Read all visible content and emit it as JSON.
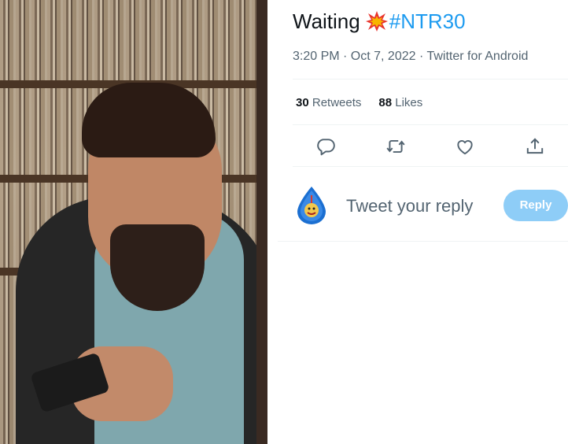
{
  "photo": {
    "alt": "Man with beard looking at phone in front of record shelves"
  },
  "tweet": {
    "text_prefix": "Waiting",
    "emoji": "collision-burst-icon",
    "hashtag": "#NTR30",
    "time": "3:20 PM",
    "separator": "·",
    "date": "Oct 7, 2022",
    "source": "Twitter for Android",
    "meta_full": "3:20 PM · Oct 7, 2022 · Twitter for Android"
  },
  "stats": {
    "retweets_count": "30",
    "retweets_label": "Retweets",
    "likes_count": "88",
    "likes_label": "Likes"
  },
  "actions": {
    "reply_icon": "reply-icon",
    "retweet_icon": "retweet-icon",
    "like_icon": "heart-icon",
    "share_icon": "share-icon"
  },
  "composer": {
    "placeholder": "Tweet your reply",
    "button_label": "Reply",
    "avatar_icon": "avatar-icon"
  },
  "colors": {
    "accent": "#1d9bf0",
    "reply_button_disabled": "#8ecdf7",
    "secondary_text": "#536471",
    "primary_text": "#0f1419",
    "divider": "#eff3f4"
  }
}
